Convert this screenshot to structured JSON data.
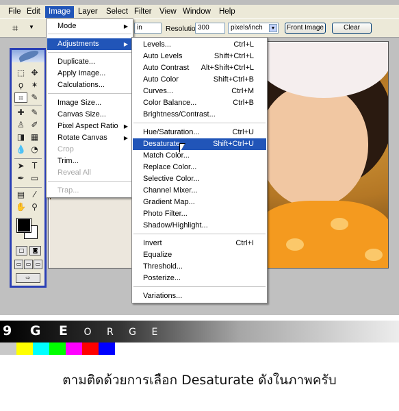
{
  "menubar": {
    "items": [
      "File",
      "Edit",
      "Image",
      "Layer",
      "Select",
      "Filter",
      "View",
      "Window",
      "Help"
    ],
    "active": "Image"
  },
  "options_bar": {
    "tool_icon": "crop-icon",
    "width_unit": "in",
    "resolution_label": "Resolution:",
    "resolution_value": "300",
    "resolution_unit": "pixels/inch",
    "front_image_label": "Front Image",
    "clear_label": "Clear"
  },
  "image_menu": {
    "items": [
      {
        "label": "Mode",
        "submenu": true
      },
      {
        "label": "Adjustments",
        "submenu": true,
        "highlighted": true
      },
      {
        "label": "Duplicate..."
      },
      {
        "label": "Apply Image..."
      },
      {
        "label": "Calculations..."
      },
      {
        "label": "Image Size..."
      },
      {
        "label": "Canvas Size..."
      },
      {
        "label": "Pixel Aspect Ratio",
        "submenu": true
      },
      {
        "label": "Rotate Canvas",
        "submenu": true
      },
      {
        "label": "Crop",
        "disabled": true
      },
      {
        "label": "Trim..."
      },
      {
        "label": "Reveal All",
        "disabled": true
      },
      {
        "label": "Trap...",
        "disabled": true
      }
    ]
  },
  "adjustments_menu": {
    "items": [
      {
        "label": "Levels...",
        "shortcut": "Ctrl+L"
      },
      {
        "label": "Auto Levels",
        "shortcut": "Shift+Ctrl+L"
      },
      {
        "label": "Auto Contrast",
        "shortcut": "Alt+Shift+Ctrl+L"
      },
      {
        "label": "Auto Color",
        "shortcut": "Shift+Ctrl+B"
      },
      {
        "label": "Curves...",
        "shortcut": "Ctrl+M"
      },
      {
        "label": "Color Balance...",
        "shortcut": "Ctrl+B"
      },
      {
        "label": "Brightness/Contrast...",
        "shortcut": ""
      },
      {
        "label": "Hue/Saturation...",
        "shortcut": "Ctrl+U"
      },
      {
        "label": "Desaturate",
        "shortcut": "Shift+Ctrl+U",
        "highlighted": true
      },
      {
        "label": "Match Color...",
        "shortcut": ""
      },
      {
        "label": "Replace Color...",
        "shortcut": ""
      },
      {
        "label": "Selective Color...",
        "shortcut": ""
      },
      {
        "label": "Channel Mixer...",
        "shortcut": ""
      },
      {
        "label": "Gradient Map...",
        "shortcut": ""
      },
      {
        "label": "Photo Filter...",
        "shortcut": ""
      },
      {
        "label": "Shadow/Highlight...",
        "shortcut": ""
      },
      {
        "label": "Invert",
        "shortcut": "Ctrl+I"
      },
      {
        "label": "Equalize",
        "shortcut": ""
      },
      {
        "label": "Threshold...",
        "shortcut": ""
      },
      {
        "label": "Posterize...",
        "shortcut": ""
      },
      {
        "label": "Variations...",
        "shortcut": ""
      }
    ]
  },
  "signature": {
    "big_letters": "9 G E",
    "small_letters": "O R G E",
    "bar_colors": [
      "#c8c8c8",
      "#ffff00",
      "#00ffff",
      "#00ff00",
      "#ff00ff",
      "#ff0000",
      "#0000ff"
    ]
  },
  "caption": "ตามติดด้วยการเลือก Desaturate ดังในภาพครับ",
  "colors": {
    "highlight": "#2155b8",
    "toolbox_border": "#2a3fb5"
  }
}
